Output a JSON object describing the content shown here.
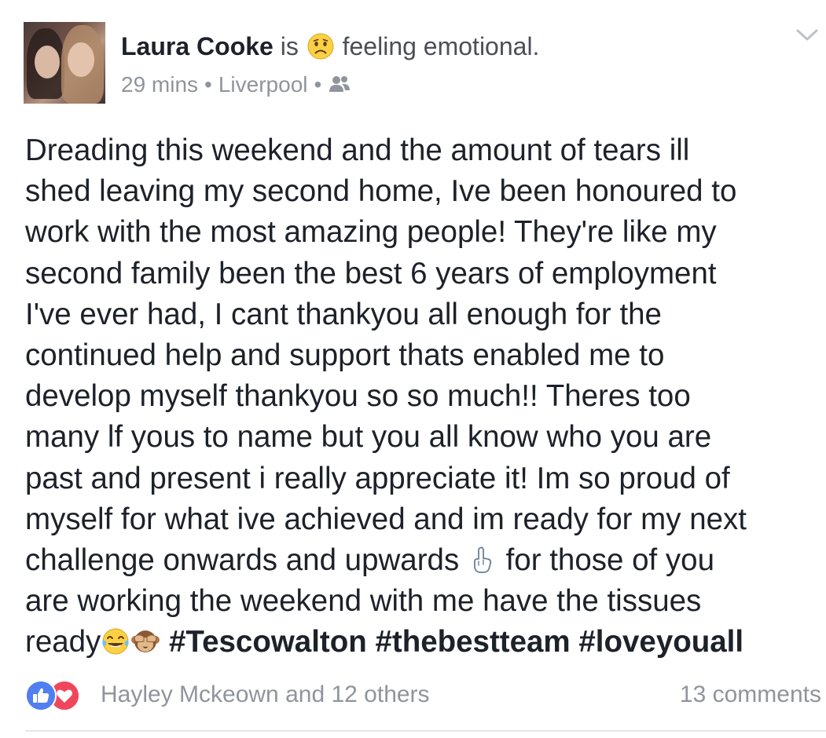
{
  "post": {
    "author": "Laura Cooke",
    "feeling_prefix": "is",
    "feeling_text": "feeling emotional.",
    "feeling_icon": "sad-face-emoji",
    "timestamp": "29 mins",
    "separator": "•",
    "location": "Liverpool",
    "audience_icon": "friends-icon",
    "body_lines": [
      "Dreading this weekend and the amount of tears ill",
      "shed leaving my second home, Ive been honoured to",
      "work with the most amazing people! They're like my",
      "second family been the best 6 years of employment",
      "I've ever had, I cant thankyou all enough for the",
      "continued help and support thats enabled me to",
      "develop myself thankyou so so much!! Theres too",
      "many lf yous to name but you all know who you are",
      "past and present i really appreciate it! Im so proud of",
      "myself for what ive achieved and im ready for my next"
    ],
    "line11_before": "challenge onwards and upwards",
    "line11_after": "for those of you",
    "line12": "are working the weekend with me have the tissues",
    "line13_start": "ready",
    "hashtags": [
      "#Tescowalton",
      "#thebestteam",
      "#loveyouall"
    ],
    "inline_emojis": [
      "pointing-up-hand-emoji",
      "tears-of-joy-emoji",
      "see-no-evil-monkey-emoji"
    ]
  },
  "footer": {
    "reactors": "Hayley Mckeown and 12 others",
    "comments": "13 comments",
    "reaction_icons": [
      "like-reaction-icon",
      "love-reaction-icon"
    ]
  },
  "colors": {
    "text": "#1d2129",
    "secondary": "#90949c",
    "like_blue": "#4f7ff0",
    "love_red": "#f0465c",
    "divider": "#e5e6e9"
  }
}
